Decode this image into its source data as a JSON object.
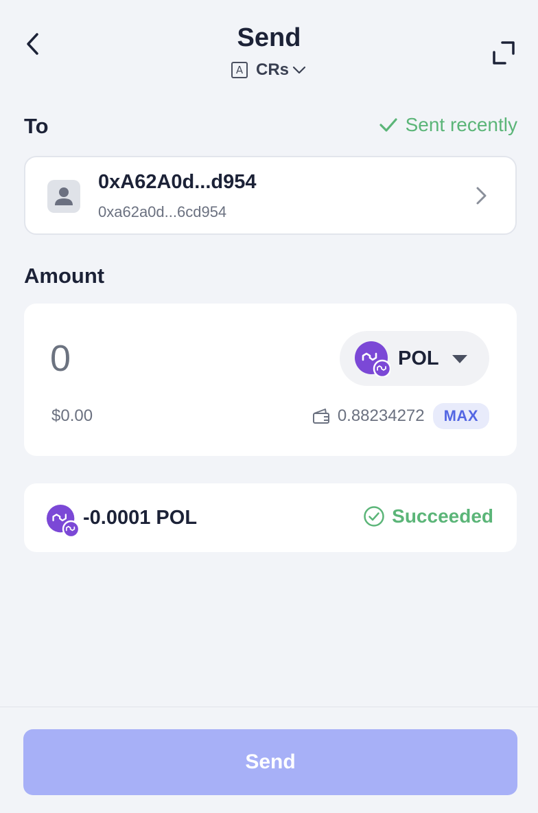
{
  "header": {
    "title": "Send",
    "account_badge": "A",
    "account_name": "CRs"
  },
  "recipient": {
    "section_label": "To",
    "sent_recently_label": "Sent recently",
    "name": "0xA62A0d...d954",
    "address": "0xa62a0d...6cd954"
  },
  "amount": {
    "section_label": "Amount",
    "value": "0",
    "token_symbol": "POL",
    "fiat_value": "$0.00",
    "balance": "0.88234272",
    "max_label": "MAX"
  },
  "transaction": {
    "amount": "-0.0001 POL",
    "status": "Succeeded"
  },
  "footer": {
    "send_label": "Send"
  },
  "colors": {
    "accent": "#a7b0f7",
    "success": "#5bb578",
    "token_purple": "#7b48d6",
    "max_text": "#5366e3"
  },
  "icons": {
    "back": "chevron-left-icon",
    "expand": "expand-icon",
    "sent_recently": "checkmark-icon",
    "recipient_chevron": "chevron-right-icon",
    "token_caret": "caret-down-icon",
    "wallet": "wallet-icon",
    "status": "check-circle-icon"
  }
}
